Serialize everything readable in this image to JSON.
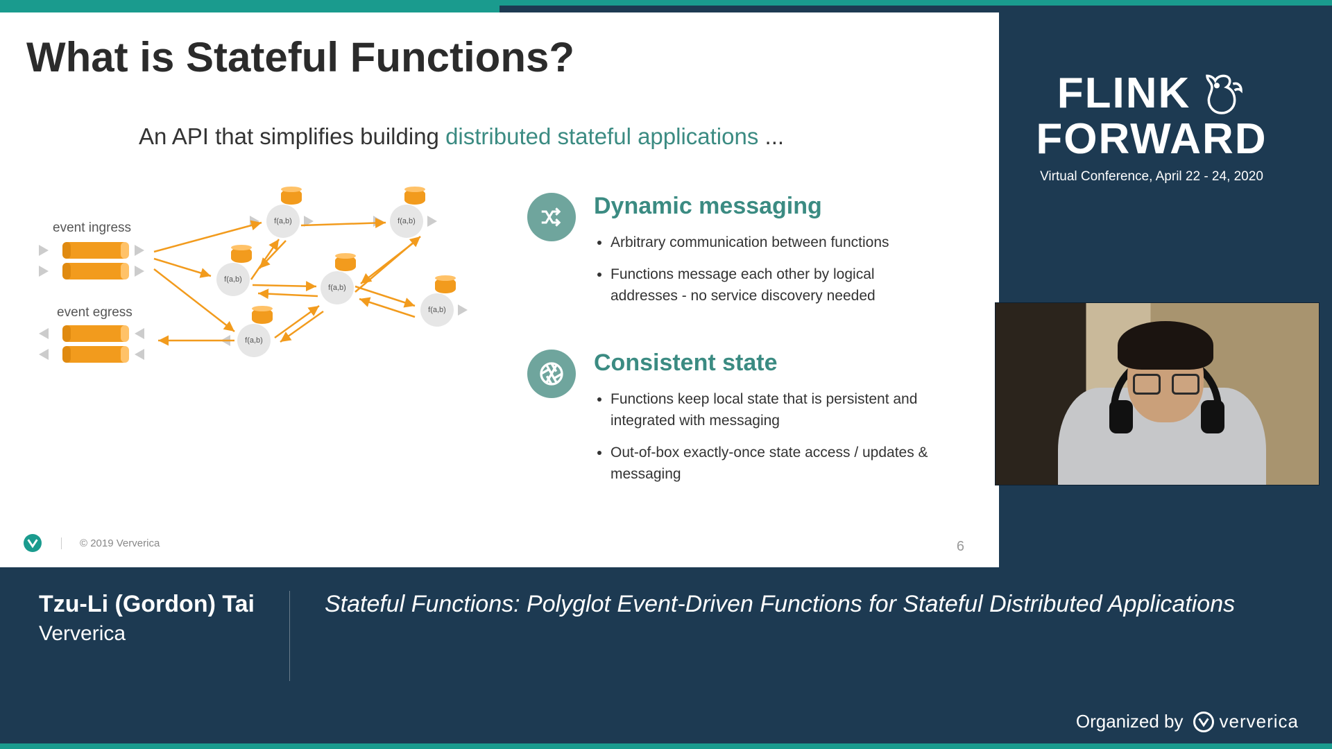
{
  "slide": {
    "title": "What is Stateful Functions?",
    "subtitle_prefix": "An API that simplifies building ",
    "subtitle_accent": "distributed stateful applications",
    "subtitle_suffix": " ...",
    "diagram": {
      "ingress_label": "event ingress",
      "egress_label": "event egress",
      "node_label": "f(a,b)"
    },
    "features": [
      {
        "title": "Dynamic messaging",
        "bullets": [
          "Arbitrary communication between functions",
          "Functions message each other by logical addresses - no service discovery needed"
        ]
      },
      {
        "title": "Consistent state",
        "bullets": [
          "Functions keep local state that is persistent and integrated with messaging",
          "Out-of-box exactly-once state access / updates & messaging"
        ]
      }
    ],
    "copyright": "© 2019 Ververica",
    "page_number": "6"
  },
  "branding": {
    "line1": "FLINK",
    "line2": "FORWARD",
    "subtitle": "Virtual Conference, April 22 - 24, 2020"
  },
  "lower_third": {
    "speaker_name": "Tzu-Li (Gordon) Tai",
    "speaker_org": "Ververica",
    "talk_title": "Stateful Functions: Polyglot Event-Driven Functions for Stateful Distributed Applications",
    "organized_by_label": "Organized by",
    "organizer": "ververica"
  }
}
